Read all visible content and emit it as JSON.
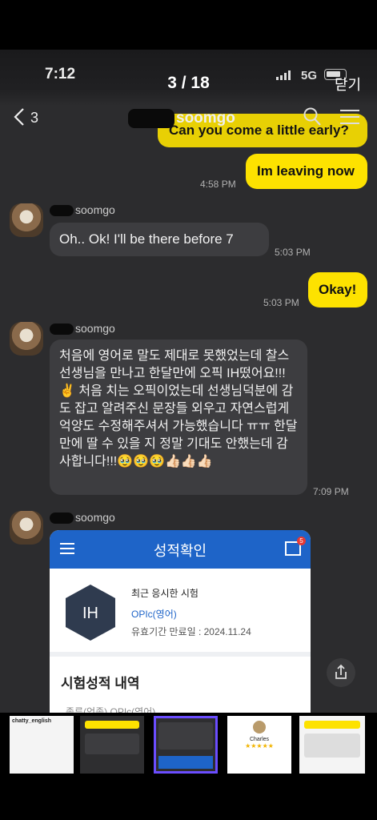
{
  "status_bar": {
    "time": "7:12",
    "network": "5G"
  },
  "viewer": {
    "counter": "3 / 18",
    "close_label": "닫기"
  },
  "chat_header": {
    "back_icon": "chevron-left-icon",
    "back_count": "3",
    "title": "soomgo",
    "search_icon": "search-icon",
    "menu_icon": "menu-icon"
  },
  "messages": [
    {
      "from": "me",
      "text": "Can you come a little early?"
    },
    {
      "from": "me",
      "text": "Im leaving now",
      "time": "4:58 PM"
    },
    {
      "from": "other",
      "sender": "soomgo",
      "text": "Oh.. Ok! I'll be there before 7",
      "time": "5:03 PM"
    },
    {
      "from": "me",
      "text": "Okay!",
      "time": "5:03 PM"
    },
    {
      "from": "other",
      "sender": "soomgo",
      "text": "처음에 영어로 말도 제대로 못했었는데 찰스선생님을 만나고 한달만에 오픽 IH떴어요!!! ✌️ 처음 치는 오픽이었는데 선생님덕분에 감도 잡고 알려주신 문장들 외우고 자연스럽게 억양도 수정해주셔서 가능했습니다 ㅠㅠ 한달만에 딸 수 있을 지 정말 기대도 안했는데 감사합니다!!!🥹🥹🥹👍🏻👍🏻👍🏻",
      "time": "7:09 PM"
    },
    {
      "from": "other",
      "sender": "soomgo",
      "type": "image"
    }
  ],
  "embedded_screenshot": {
    "header_title": "성적확인",
    "badge": "5",
    "grade": "IH",
    "recent_label": "최근 응시한 시험",
    "test_name": "OPIc(영어)",
    "expiry": "유효기간 만료일 : 2024.11.24",
    "section_title": "시험성적 내역",
    "partial_row": "종류(언종)   OPIc(영어)"
  },
  "colors": {
    "my_bubble": "#fde200",
    "other_bubble": "#3d3d40",
    "chat_bg": "#2c2c2e",
    "app_blue": "#1e64c8",
    "thumb_selected": "#6b4dff"
  },
  "thumbnails": [
    {
      "label": "chatty_english",
      "selected": false
    },
    {
      "label": "chat",
      "selected": false
    },
    {
      "label": "chat",
      "selected": true
    },
    {
      "label": "Charles",
      "selected": false
    },
    {
      "label": "chat",
      "selected": false
    }
  ]
}
